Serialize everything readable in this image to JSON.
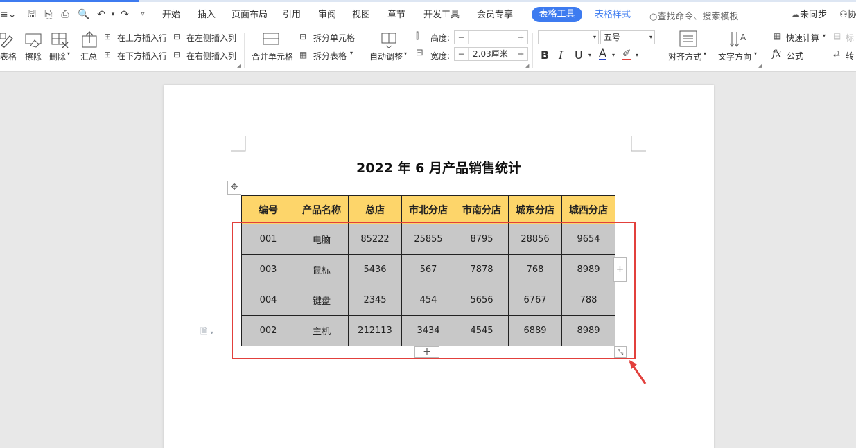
{
  "menubar": {
    "items": [
      "开始",
      "插入",
      "页面布局",
      "引用",
      "审阅",
      "视图",
      "章节",
      "开发工具",
      "会员专享"
    ],
    "active_tab": "表格工具",
    "style_tab": "表格样式",
    "search_placeholder": "查找命令、搜索模板",
    "sync_label": "未同步",
    "collab_label": "协"
  },
  "ribbon": {
    "draw_table": "表格",
    "erase": "擦除",
    "delete": "删除",
    "summary": "汇总",
    "insert_above": "在上方插入行",
    "insert_below": "在下方插入行",
    "insert_left": "在左侧插入列",
    "insert_right": "在右侧插入列",
    "merge_cells": "合并单元格",
    "split_cells": "拆分单元格",
    "split_table": "拆分表格",
    "auto_fit": "自动调整",
    "height_label": "高度:",
    "height_value": "",
    "width_label": "宽度:",
    "width_value": "2.03厘米",
    "font_name": "",
    "font_size": "五号",
    "align": "对齐方式",
    "text_direction": "文字方向",
    "quick_calc": "快速计算",
    "formula": "公式",
    "title_row": "标",
    "convert": "转"
  },
  "document": {
    "title": "2022 年 6 月产品销售统计",
    "table": {
      "headers": [
        "编号",
        "产品名称",
        "总店",
        "市北分店",
        "市南分店",
        "城东分店",
        "城西分店"
      ],
      "rows": [
        [
          "001",
          "电脑",
          "85222",
          "25855",
          "8795",
          "28856",
          "9654"
        ],
        [
          "003",
          "鼠标",
          "5436",
          "567",
          "7878",
          "768",
          "8989"
        ],
        [
          "004",
          "键盘",
          "2345",
          "454",
          "5656",
          "6767",
          "788"
        ],
        [
          "002",
          "主机",
          "212113",
          "3434",
          "4545",
          "6889",
          "8989"
        ]
      ]
    }
  },
  "colors": {
    "accent": "#3d7bf0",
    "header_fill": "#fdd56a",
    "cell_fill": "#c8c8c8",
    "highlight": "#e2403c"
  }
}
